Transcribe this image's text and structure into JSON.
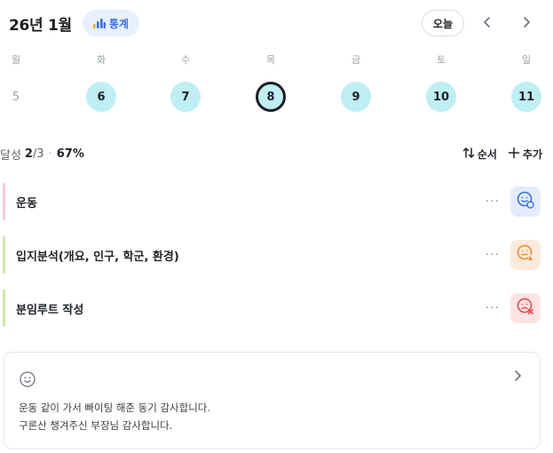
{
  "header": {
    "month_title": "26년 1월",
    "stats_label": "통계",
    "today_label": "오늘",
    "prev_icon": "chevron-left-icon",
    "next_icon": "chevron-right-icon"
  },
  "week": [
    {
      "name": "월",
      "num": "5",
      "state": "plain"
    },
    {
      "name": "화",
      "num": "6",
      "state": "filled"
    },
    {
      "name": "수",
      "num": "7",
      "state": "filled"
    },
    {
      "name": "목",
      "num": "8",
      "state": "today"
    },
    {
      "name": "금",
      "num": "9",
      "state": "filled"
    },
    {
      "name": "토",
      "num": "10",
      "state": "filled"
    },
    {
      "name": "일",
      "num": "11",
      "state": "filled"
    }
  ],
  "summary": {
    "label": "달성",
    "count": "2",
    "total": "/3",
    "dot": "·",
    "percent": "67%",
    "order_label": "순서",
    "add_label": "추가"
  },
  "tasks": [
    {
      "title": "운동",
      "bar_color": "#f7c7d2",
      "status": "smile-blue",
      "status_bg": "#e3ecfc",
      "status_color": "#3b6fe0"
    },
    {
      "title": "입지분석(개요, 인구, 학군, 환경)",
      "bar_color": "#cfe8a9",
      "status": "meh-orange",
      "status_bg": "#fdeadb",
      "status_color": "#f08a34"
    },
    {
      "title": "분임루트 작성",
      "bar_color": "#cfe8a9",
      "status": "sad-red",
      "status_bg": "#fde4e4",
      "status_color": "#e5484d"
    }
  ],
  "more_label": "···",
  "note": {
    "icon": "smile-icon",
    "lines": [
      "운동 같이 가서 빠이팅 해준 동기 감사합니다.",
      "구론산 챙겨주신 부장님 감사합니다."
    ]
  }
}
